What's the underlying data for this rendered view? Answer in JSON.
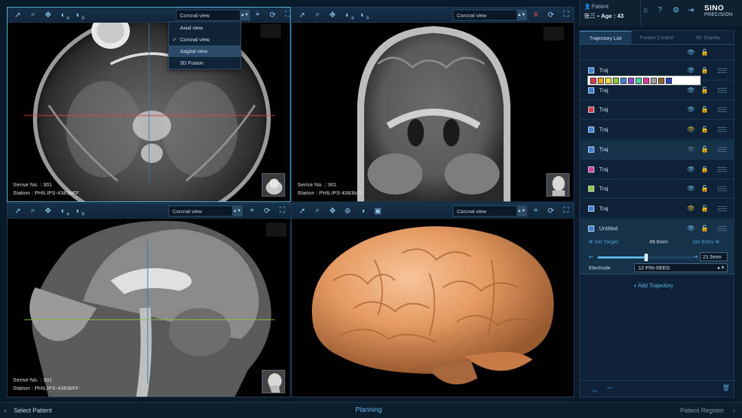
{
  "colors": {
    "accent": "#5bb8e0",
    "bg": "#0b1a2a",
    "panel": "#0d2236"
  },
  "viewports": {
    "top_left": {
      "view_select": "Corcnal view",
      "series": "Serise No. : 301",
      "station": "Station : PHILIPS-4383bFF"
    },
    "top_right": {
      "view_select": "Corcnal view",
      "series": "Serise No. : 301",
      "station": "Station : PHILIPS-4383bFF"
    },
    "bottom_left": {
      "view_select": "Corcnal view",
      "series": "Serise No. : 301",
      "station": "Station : PHILIPS-4383bFF"
    },
    "bottom_right": {
      "view_select": "Corcnal view"
    }
  },
  "view_menu": {
    "items": [
      "Axial view",
      "Corcnal view",
      "Sagital view",
      "3D Fusion"
    ],
    "checked_index": 1,
    "hover_index": 2
  },
  "toolbar": {
    "icons": [
      "pointer-icon",
      "zoom-icon",
      "pan-icon",
      "window-a-icon",
      "window-b-icon",
      "crosshair-icon",
      "rotate-icon",
      "fullscreen-icon"
    ],
    "label_a": "a",
    "label_b": "b"
  },
  "patient": {
    "label": "Patient",
    "name": "张三",
    "age": "Age : 43"
  },
  "brand": {
    "line1": "SINO",
    "line2": "PRECISION"
  },
  "side_tabs": [
    "Trajectory List",
    "Fusion Control",
    "3D Display"
  ],
  "trajectories": [
    {
      "label": "Traj",
      "color": "#3b7fd6",
      "locked": true,
      "lock_color": "#e03b3b",
      "eye": "#6ec3ec"
    },
    {
      "label": "Traj",
      "color": "#3b7fd6",
      "locked": false,
      "eye": "#6ec3ec"
    },
    {
      "label": "Traj",
      "color": "#d83b4a",
      "locked": false,
      "eye": "#6ec3ec"
    },
    {
      "label": "Traj",
      "color": "#3b7fd6",
      "locked": false,
      "eye": "#e0c040"
    },
    {
      "label": "Traj",
      "color": "#3b7fd6",
      "locked": false,
      "eye": "#5a7890"
    },
    {
      "label": "Traj",
      "color": "#d83b9a",
      "locked": true,
      "lock_color": "#e03b3b",
      "eye": "#6ec3ec"
    },
    {
      "label": "Traj",
      "color": "#8cc63f",
      "locked": false,
      "eye": "#6ec3ec"
    },
    {
      "label": "Traj",
      "color": "#3b7fd6",
      "locked": false,
      "eye": "#e0c040"
    },
    {
      "label": "Untitled",
      "color": "#3b7fd6",
      "locked": false,
      "eye": "#6ec3ec"
    }
  ],
  "palette": [
    "#d83b4a",
    "#f0a020",
    "#f0e040",
    "#8cc63f",
    "#3b7fd6",
    "#8a4ad6",
    "#46d6a0",
    "#d83b9a",
    "#a0a0a0",
    "#8a6a30",
    "#2a40c0"
  ],
  "detail": {
    "set_target": "Set Target",
    "distance": "49.6mm",
    "set_entry": "Set Entry",
    "depth_value": "21.5mm",
    "depth_fraction": 0.5,
    "electrode_label": "Electrode",
    "electrode_value": "12 PIN-SEEG"
  },
  "add_trajectory": "+ Add Trajectory",
  "bottom": {
    "left": "Select Patient",
    "center": "Planning",
    "right": "Patient Register"
  }
}
